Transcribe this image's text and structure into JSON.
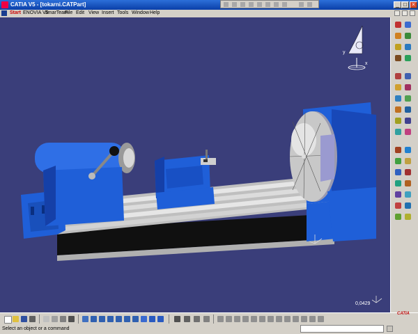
{
  "window": {
    "title": "CATIA V5 - [tokarni.CATPart]",
    "minimize": "_",
    "maximize": "□",
    "close": "×"
  },
  "menu": {
    "items": [
      "Start",
      "ENOVIA V5",
      "SmarTeam",
      "File",
      "Edit",
      "View",
      "Insert",
      "Tools",
      "Window",
      "Help"
    ]
  },
  "compass": {
    "x_label": "x",
    "y_label": "y"
  },
  "viewport": {
    "zoom_readout": "0,0429",
    "background": "#3a3e7a"
  },
  "status": {
    "message": "Select an object or a command",
    "command_value": ""
  },
  "logo": "CATIA",
  "colors": {
    "machine_blue": "#1f5fd8",
    "rail_grey": "#c8c8c8",
    "base_black": "#101010"
  }
}
